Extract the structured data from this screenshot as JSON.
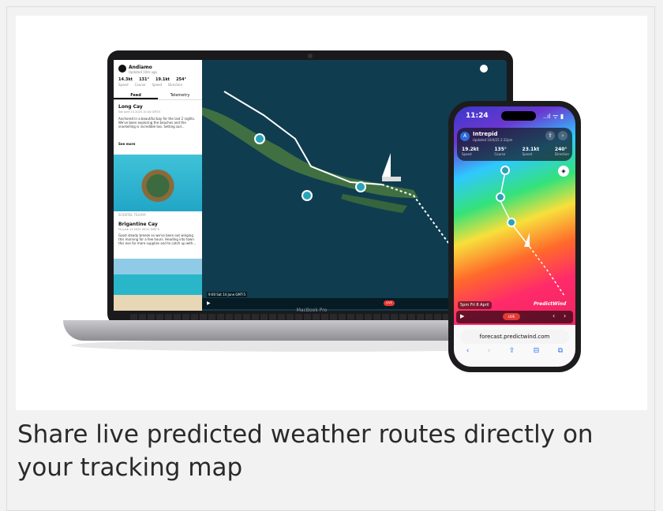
{
  "caption": "Share live predicted weather routes directly on your tracking map",
  "laptop": {
    "brand": "MacBook Pro",
    "panel": {
      "vessel_name": "Andiamo",
      "vessel_sub": "Updated 10m ago",
      "stats": [
        {
          "value": "14.3kt",
          "label": "Speed"
        },
        {
          "value": "131°",
          "label": "Course"
        },
        {
          "value": "19.1kt",
          "label": "Speed"
        },
        {
          "value": "254°",
          "label": "Direction"
        }
      ],
      "tabs": [
        "Feed",
        "Telemetry"
      ],
      "post1": {
        "title": "Long Cay",
        "date": "Sat June 14 2025 10:44 GMT-5",
        "body": "Anchored in a beautiful bay for the last 2 nights. We've been exploring the beaches and the snorkelling is incredible too. Setting sail..."
      },
      "see_more": "See more",
      "mid_label": "SCENTBL TEUAYA",
      "post2": {
        "title": "Brigantine Cay",
        "date": "Fri June 13 2025 09:31 GMT-5",
        "body": "Good steady breeze so we've been out winging this morning for a few hours. Heading into town this eve for more supplies and to catch up with..."
      }
    },
    "time_label": "9:00 Sat 14 June GMT-5",
    "live": "LIVE"
  },
  "phone": {
    "time": "11:24",
    "status": "..ıl ᯤ ▮",
    "vessel_initial": "A",
    "vessel_name": "Intrepid",
    "vessel_sub": "Updated 10/4/25 2:32pm",
    "stats": [
      {
        "value": "19.2kt",
        "label": "Speed"
      },
      {
        "value": "135°",
        "label": "Course"
      },
      {
        "value": "23.1kt",
        "label": "Speed"
      },
      {
        "value": "240°",
        "label": "Direction"
      }
    ],
    "date_label": "5pm Fri 8 April",
    "brand": "PredictWind",
    "live": "LIVE",
    "url": "forecast.predictwind.com"
  }
}
